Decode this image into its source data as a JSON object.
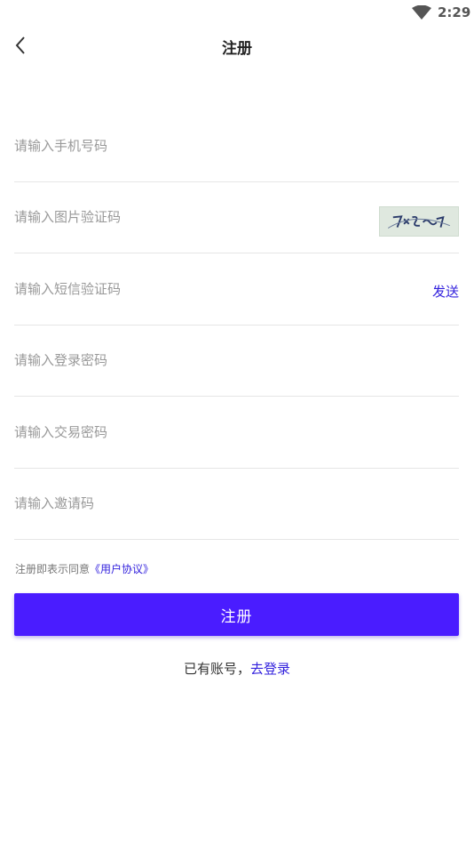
{
  "status_bar": {
    "time": "2:29",
    "wifi_icon": "wifi-icon"
  },
  "header": {
    "back_icon": "chevron-left-icon",
    "title": "注册"
  },
  "form": {
    "phone_placeholder": "请输入手机号码",
    "image_code_placeholder": "请输入图片验证码",
    "captcha_image_icon": "captcha-image",
    "sms_code_placeholder": "请输入短信验证码",
    "send_label": "发送",
    "login_password_placeholder": "请输入登录密码",
    "trade_password_placeholder": "请输入交易密码",
    "invite_code_placeholder": "请输入邀请码"
  },
  "agreement": {
    "prefix": "注册即表示同意",
    "link_text": "《用户协议》"
  },
  "submit_label": "注册",
  "login_prompt": {
    "text": "已有账号，",
    "link_text": "去登录"
  },
  "colors": {
    "accent": "#4a1cff",
    "link": "#3322dd",
    "divider": "#e6e6e6",
    "placeholder": "#999999"
  }
}
